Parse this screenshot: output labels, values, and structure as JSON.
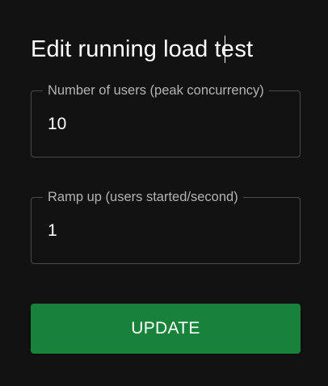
{
  "dialog": {
    "title_before_caret": "Edit running load te",
    "title_after_caret": "st"
  },
  "fields": {
    "users": {
      "label": "Number of users (peak concurrency)",
      "value": "10"
    },
    "ramp_up": {
      "label": "Ramp up (users started/second)",
      "value": "1"
    }
  },
  "actions": {
    "update_label": "UPDATE"
  },
  "colors": {
    "background": "#121212",
    "button": "#18823a",
    "border": "#4a4a4a",
    "label": "#b3b3b3"
  }
}
